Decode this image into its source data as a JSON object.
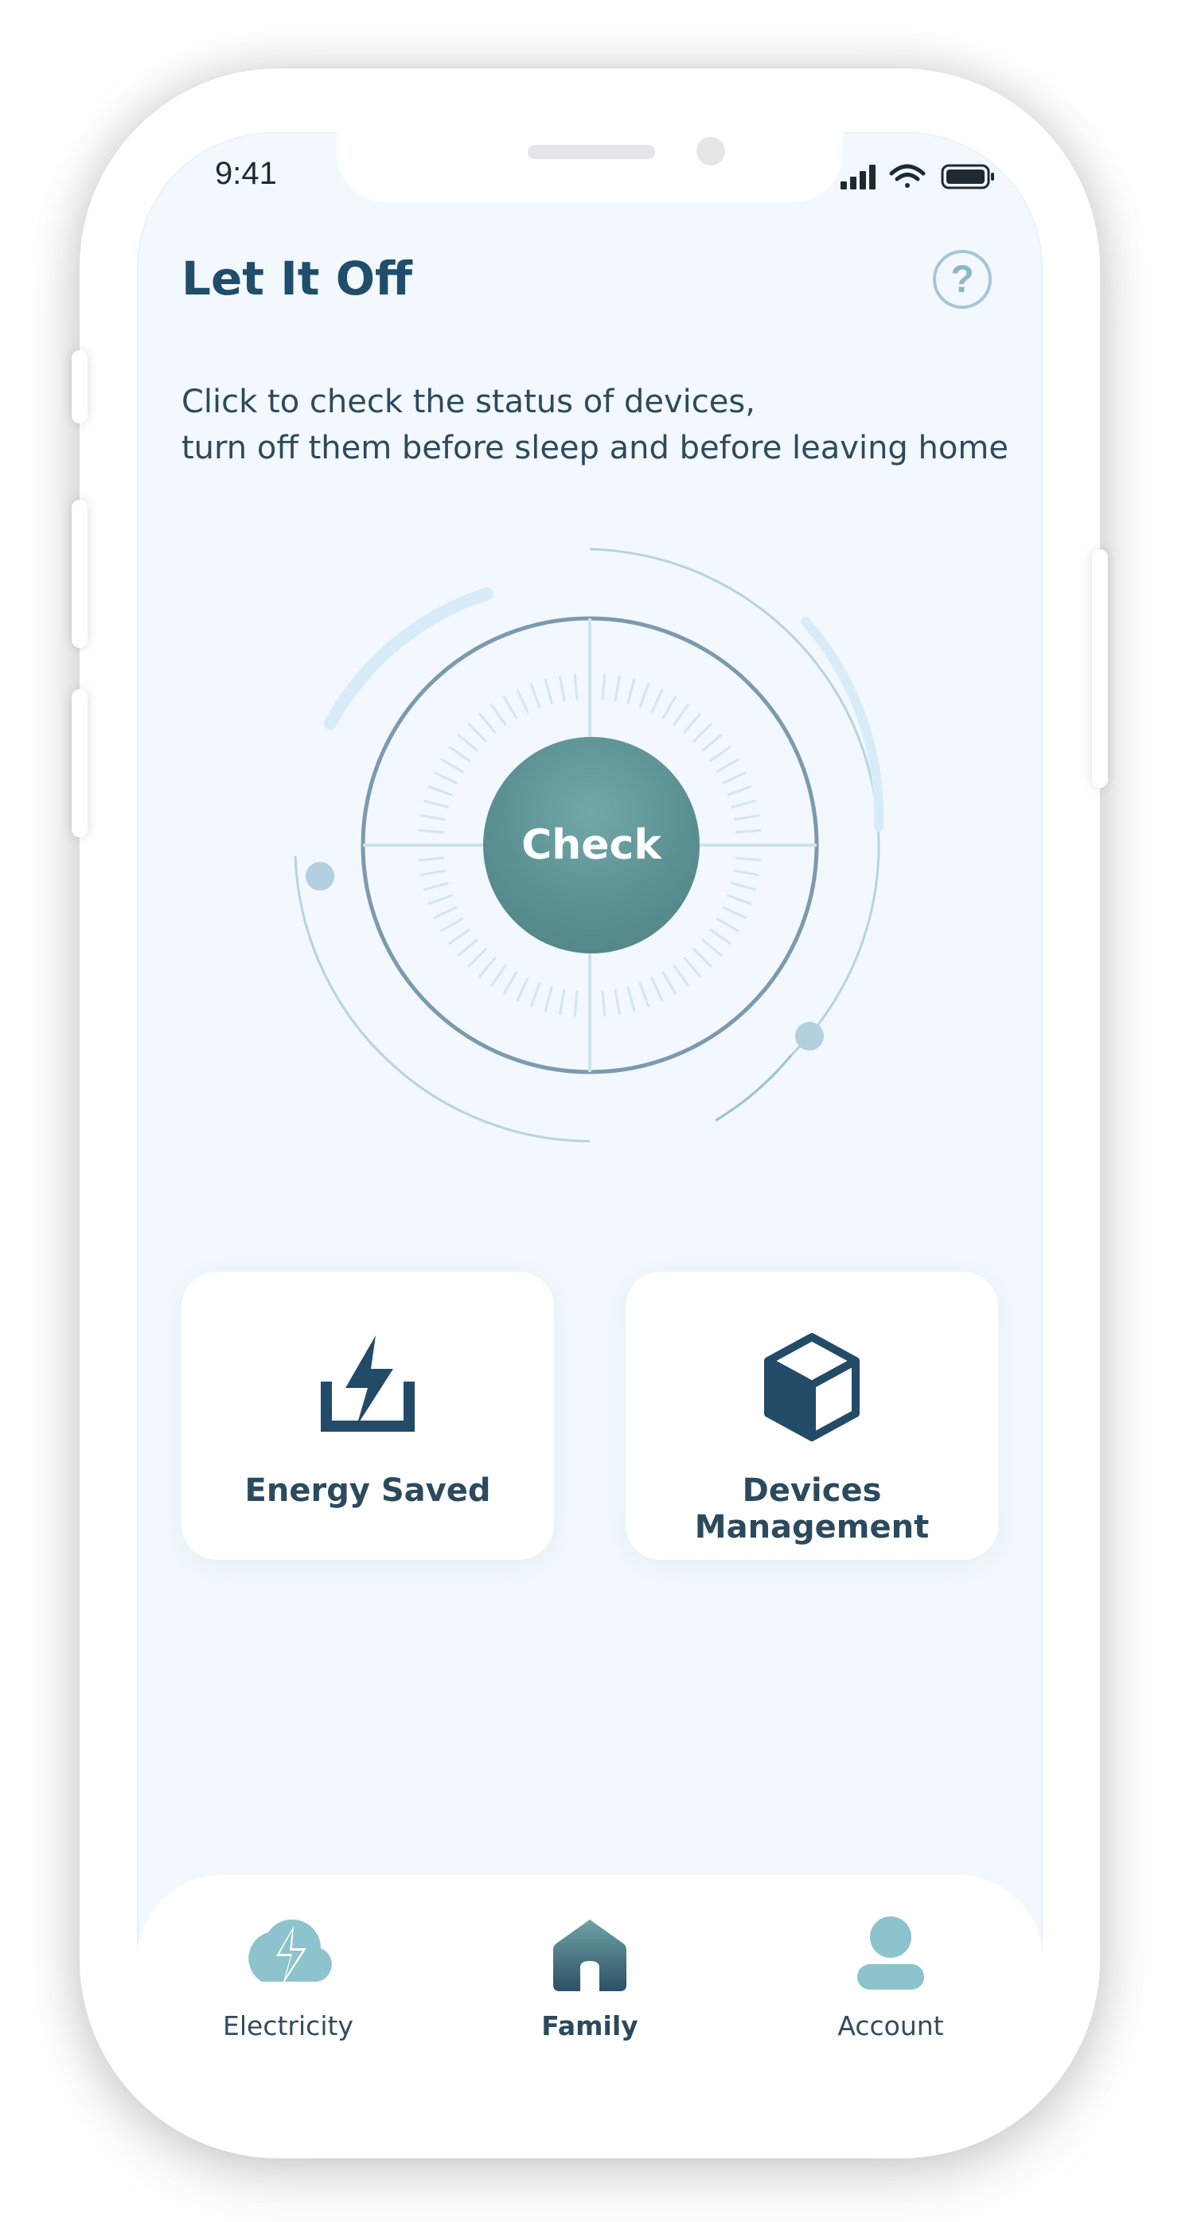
{
  "status_bar": {
    "time": "9:41"
  },
  "header": {
    "title": "Let It Off",
    "help_symbol": "?"
  },
  "description": {
    "line1": "Click to check the status of devices,",
    "line2": "turn off them before sleep and before leaving home"
  },
  "main_button": {
    "label": "Check"
  },
  "cards": [
    {
      "label": "Energy Saved",
      "icon": "energy-saved-icon"
    },
    {
      "label": "Devices Management",
      "icon": "box-icon"
    }
  ],
  "tabbar": {
    "items": [
      {
        "label": "Electricity",
        "icon": "lightning-cloud-icon",
        "active": false
      },
      {
        "label": "Family",
        "icon": "home-icon",
        "active": true
      },
      {
        "label": "Account",
        "icon": "user-icon",
        "active": false
      }
    ]
  },
  "colors": {
    "primary_dark": "#1f4d6a",
    "accent_teal": "#5a9092",
    "background": "#f2f8fd",
    "tab_inactive_icon": "#8cc3cc"
  }
}
